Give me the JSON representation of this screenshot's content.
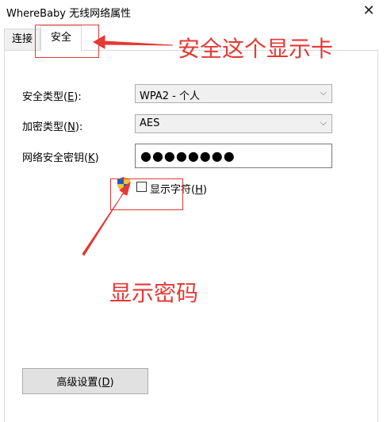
{
  "window": {
    "title": "WhereBaby 无线网络属性",
    "close_glyph": "✕"
  },
  "tabs": [
    {
      "label": "连接",
      "selected": false
    },
    {
      "label": "安全",
      "selected": true
    }
  ],
  "form": {
    "security_type": {
      "label_pre": "安全类型(",
      "mnemonic": "E",
      "label_post": "):",
      "value": "WPA2 - 个人"
    },
    "encryption_type": {
      "label_pre": "加密类型(",
      "mnemonic": "N",
      "label_post": "):",
      "value": "AES"
    },
    "network_key": {
      "label_pre": "网络安全密钥(",
      "mnemonic": "K",
      "label_post": ")",
      "value": "●●●●●●●●"
    },
    "show_chars": {
      "label_pre": "显示字符(",
      "mnemonic": "H",
      "label_post": ")",
      "checked": false
    }
  },
  "advanced_button": {
    "label_pre": "高级设置(",
    "mnemonic": "D",
    "label_post": ")"
  },
  "annotations": {
    "tab_note": "安全这个显示卡",
    "password_note": "显示密码",
    "color": "#e53935"
  },
  "icons": {
    "close": "close-icon",
    "chevron": "chevron-down-icon",
    "shield": "uac-shield-icon"
  }
}
